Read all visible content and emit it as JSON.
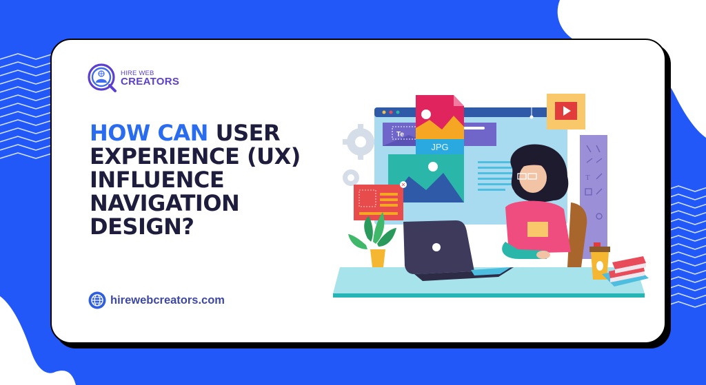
{
  "brand": {
    "name_line1": "HIRE WEB",
    "name_line2": "CREATORS",
    "logo_icon": "globe-person-magnifier-icon"
  },
  "headline": {
    "accent_part": "HOW CAN",
    "rest_line1": " USER",
    "line2": "EXPERIENCE (UX)",
    "line3": "INFLUENCE",
    "line4": "NAVIGATION",
    "line5": "DESIGN?"
  },
  "website": {
    "icon": "globe-icon",
    "url": "hirewebcreators.com"
  },
  "illustration": {
    "file_label": "JPG",
    "text_placeholder": "Te",
    "description": "woman with glasses working on laptop at desk in front of large web-design screen"
  },
  "colors": {
    "background_blue": "#2358f8",
    "accent_blue": "#2a6cf0",
    "headline_dark": "#1f1d3d",
    "brand_purple": "#5a3fd0",
    "card_white": "#ffffff"
  }
}
